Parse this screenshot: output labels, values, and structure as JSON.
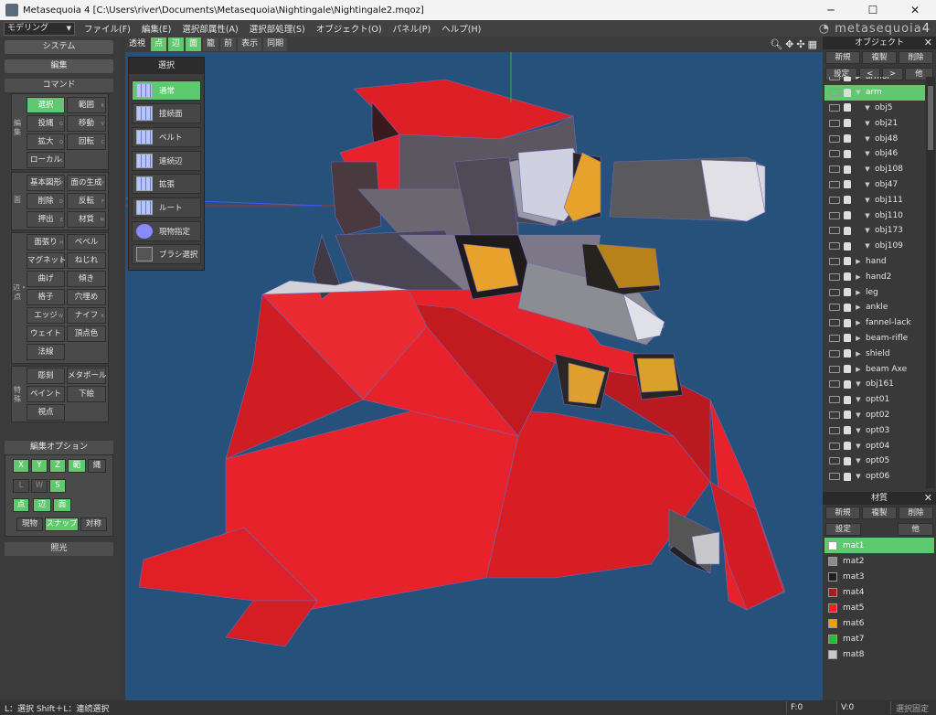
{
  "window": {
    "title": "Metasequoia 4 [C:\\Users\\river\\Documents\\Metasequoia\\Nightingale\\Nightingale2.mqoz]"
  },
  "menubar": {
    "mode": "モデリング",
    "items": [
      "ファイル(F)",
      "編集(E)",
      "選択部属性(A)",
      "選択部処理(S)",
      "オブジェクト(O)",
      "パネル(P)",
      "ヘルプ(H)"
    ],
    "logo": "metasequoia",
    "logo_num": "4"
  },
  "left": {
    "system": "システム",
    "edit": "編集",
    "command": "コマンド",
    "group_labels": [
      "編集",
      "面",
      "辺・点",
      "特殊"
    ],
    "commands": [
      {
        "label": "選択",
        "key": "B"
      },
      {
        "label": "範囲",
        "key": "R"
      },
      {
        "label": "投縄",
        "key": "G"
      },
      {
        "label": "移動",
        "key": "V"
      },
      {
        "label": "拡大",
        "key": "Q"
      },
      {
        "label": "回転",
        "key": "C"
      },
      {
        "label": "ローカル",
        "key": "L"
      },
      {
        "label": "基本図形",
        "key": "P"
      },
      {
        "label": "面の生成",
        "key": "F"
      },
      {
        "label": "削除",
        "key": "D"
      },
      {
        "label": "反転",
        "key": "F"
      },
      {
        "label": "押出",
        "key": "E"
      },
      {
        "label": "材質",
        "key": "M"
      },
      {
        "label": "面張り",
        "key": "H"
      },
      {
        "label": "ベベル",
        "key": ""
      },
      {
        "label": "マグネット",
        "key": "B"
      },
      {
        "label": "ねじれ",
        "key": ""
      },
      {
        "label": "曲げ",
        "key": ""
      },
      {
        "label": "傾き",
        "key": ""
      },
      {
        "label": "格子",
        "key": ""
      },
      {
        "label": "穴埋め",
        "key": ""
      },
      {
        "label": "エッジ",
        "key": "W"
      },
      {
        "label": "ナイフ",
        "key": "K"
      },
      {
        "label": "ウェイト",
        "key": ""
      },
      {
        "label": "頂点色",
        "key": ""
      },
      {
        "label": "法線",
        "key": ""
      },
      {
        "label": "彫刻",
        "key": ""
      },
      {
        "label": "メタボール",
        "key": ""
      },
      {
        "label": "ペイント",
        "key": ""
      },
      {
        "label": "下絵",
        "key": ""
      },
      {
        "label": "視点",
        "key": ""
      }
    ],
    "edit_options": "編集オプション",
    "opt_xyz": [
      "X",
      "Y",
      "Z"
    ],
    "opt_kan": "範",
    "opt_nawa": "縄",
    "opt_lws": [
      "L",
      "W",
      "S"
    ],
    "opt_pts": [
      "点",
      "辺",
      "面"
    ],
    "opt_bottom": [
      "現物",
      "スナップ",
      "対称"
    ],
    "light": "照光"
  },
  "toolbar": {
    "items": [
      "透視",
      "点",
      "辺",
      "面",
      "籠",
      "前",
      "表示",
      "同期"
    ]
  },
  "select_panel": {
    "title": "選択",
    "items": [
      "通常",
      "接続面",
      "ベルト",
      "連続辺",
      "拡張",
      "ルート",
      "現物指定",
      "ブラシ選択"
    ]
  },
  "objects": {
    "title": "オブジェクト",
    "buttons1": [
      "新規",
      "複製",
      "削除"
    ],
    "buttons2": [
      "設定",
      "<",
      ">",
      "他"
    ],
    "items": [
      {
        "name": "armor",
        "arrow": "▶",
        "indent": 0
      },
      {
        "name": "arm",
        "arrow": "▼",
        "indent": 0
      },
      {
        "name": "obj5",
        "arrow": "▼",
        "indent": 1
      },
      {
        "name": "obj21",
        "arrow": "▼",
        "indent": 1
      },
      {
        "name": "obj48",
        "arrow": "▼",
        "indent": 1
      },
      {
        "name": "obj46",
        "arrow": "▼",
        "indent": 1
      },
      {
        "name": "obj108",
        "arrow": "▼",
        "indent": 1
      },
      {
        "name": "obj47",
        "arrow": "▼",
        "indent": 1
      },
      {
        "name": "obj111",
        "arrow": "▼",
        "indent": 1
      },
      {
        "name": "obj110",
        "arrow": "▼",
        "indent": 1
      },
      {
        "name": "obj173",
        "arrow": "▼",
        "indent": 1
      },
      {
        "name": "obj109",
        "arrow": "▼",
        "indent": 1
      },
      {
        "name": "hand",
        "arrow": "▶",
        "indent": 0
      },
      {
        "name": "hand2",
        "arrow": "▶",
        "indent": 0
      },
      {
        "name": "leg",
        "arrow": "▶",
        "indent": 0
      },
      {
        "name": "ankle",
        "arrow": "▶",
        "indent": 0
      },
      {
        "name": "fannel-lack",
        "arrow": "▶",
        "indent": 0
      },
      {
        "name": "beam-rifle",
        "arrow": "▶",
        "indent": 0
      },
      {
        "name": "shield",
        "arrow": "▶",
        "indent": 0
      },
      {
        "name": "beam Axe",
        "arrow": "▶",
        "indent": 0
      },
      {
        "name": "obj161",
        "arrow": "▼",
        "indent": 0
      },
      {
        "name": "opt01",
        "arrow": "▼",
        "indent": 0
      },
      {
        "name": "opt02",
        "arrow": "▼",
        "indent": 0
      },
      {
        "name": "opt03",
        "arrow": "▼",
        "indent": 0
      },
      {
        "name": "opt04",
        "arrow": "▼",
        "indent": 0
      },
      {
        "name": "opt05",
        "arrow": "▼",
        "indent": 0
      },
      {
        "name": "opt06",
        "arrow": "▼",
        "indent": 0
      }
    ]
  },
  "materials": {
    "title": "材質",
    "buttons1": [
      "新規",
      "複製",
      "削除"
    ],
    "buttons2": [
      "設定",
      "他"
    ],
    "items": [
      {
        "name": "mat1",
        "color": "#ffffff"
      },
      {
        "name": "mat2",
        "color": "#8c8c8c"
      },
      {
        "name": "mat3",
        "color": "#1e1e1e"
      },
      {
        "name": "mat4",
        "color": "#b01818"
      },
      {
        "name": "mat5",
        "color": "#ff1f1f"
      },
      {
        "name": "mat6",
        "color": "#f0a000"
      },
      {
        "name": "mat7",
        "color": "#22c02a"
      },
      {
        "name": "mat8",
        "color": "#c8c8c8"
      }
    ]
  },
  "status": {
    "hint": "L：選択  Shift＋L：連続選択",
    "f": "F:0",
    "v": "V:0",
    "fixed": "選択固定"
  },
  "colors": {
    "accent": "#5fc96f",
    "viewport": "#26517a",
    "red": "#e8222a"
  }
}
